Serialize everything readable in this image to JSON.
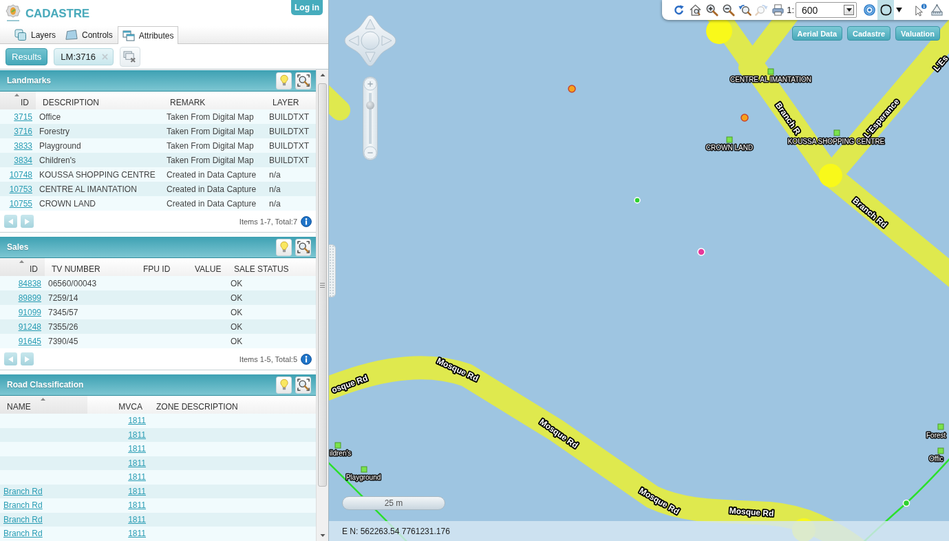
{
  "header": {
    "title": "CADASTRE",
    "login_button": "Log in"
  },
  "tabs": [
    {
      "label": "Layers",
      "selected": false
    },
    {
      "label": "Controls",
      "selected": false
    },
    {
      "label": "Attributes",
      "selected": true
    }
  ],
  "result_bar": {
    "results_button": "Results",
    "filter_chip": "LM:3716"
  },
  "panels": [
    {
      "title": "Landmarks",
      "columns": [
        {
          "label": "ID",
          "kind": "link",
          "sorted": true
        },
        {
          "label": "DESCRIPTION",
          "kind": "text",
          "sorted": false
        },
        {
          "label": "REMARK",
          "kind": "text",
          "sorted": false
        },
        {
          "label": "LAYER",
          "kind": "text",
          "sorted": false
        }
      ],
      "rows": [
        {
          "id": "3715",
          "description": "Office",
          "remark": "Taken From Digital Map",
          "layer": "BUILDTXT"
        },
        {
          "id": "3716",
          "description": "Forestry",
          "remark": "Taken From Digital Map",
          "layer": "BUILDTXT"
        },
        {
          "id": "3833",
          "description": "Playground",
          "remark": "Taken From Digital Map",
          "layer": "BUILDTXT"
        },
        {
          "id": "3834",
          "description": "Children's",
          "remark": "Taken From Digital Map",
          "layer": "BUILDTXT"
        },
        {
          "id": "10748",
          "description": "KOUSSA SHOPPING CENTRE",
          "remark": "Created in Data Capture",
          "layer": "n/a"
        },
        {
          "id": "10753",
          "description": "CENTRE AL IMANTATION",
          "remark": "Created in Data Capture",
          "layer": "n/a"
        },
        {
          "id": "10755",
          "description": "CROWN LAND",
          "remark": "Created in Data Capture",
          "layer": "n/a"
        }
      ],
      "footer": "Items 1-7, Total:7"
    },
    {
      "title": "Sales",
      "columns": [
        {
          "label": "ID",
          "kind": "link",
          "sorted": true
        },
        {
          "label": "TV NUMBER",
          "kind": "text",
          "sorted": false
        },
        {
          "label": "FPU ID",
          "sorted": false
        },
        {
          "label": "VALUE",
          "sorted": false
        },
        {
          "label": "SALE STATUS",
          "kind": "text",
          "sorted": false
        }
      ],
      "rows": [
        {
          "id": "84838",
          "tv_number": "06560/00043",
          "sale_status": "OK"
        },
        {
          "id": "89899",
          "tv_number": "7259/14",
          "sale_status": "OK"
        },
        {
          "id": "91099",
          "tv_number": "7345/57",
          "sale_status": "OK"
        },
        {
          "id": "91248",
          "tv_number": "7355/26",
          "sale_status": "OK"
        },
        {
          "id": "91645",
          "tv_number": "7390/45",
          "sale_status": "OK"
        }
      ],
      "footer": "Items 1-5, Total:5"
    },
    {
      "title": "Road Classification",
      "columns": [
        {
          "label": "NAME",
          "kind": "link",
          "sorted": true
        },
        {
          "label": "MVCA",
          "kind": "link",
          "sorted": false
        },
        {
          "label": "ZONE DESCRIPTION",
          "sorted": false
        }
      ],
      "rows": [
        {
          "mvca": "1811"
        },
        {
          "mvca": "1811"
        },
        {
          "mvca": "1811"
        },
        {
          "mvca": "1811"
        },
        {
          "mvca": "1811"
        },
        {
          "name": "Branch Rd",
          "mvca": "1811"
        },
        {
          "name": "Branch Rd",
          "mvca": "1811"
        },
        {
          "name": "Branch Rd",
          "mvca": "1811"
        },
        {
          "name": "Branch Rd",
          "mvca": "1811"
        }
      ]
    }
  ],
  "map": {
    "toolbar": {
      "tools": [
        {
          "selected": false,
          "disabled": false
        },
        {
          "selected": false,
          "disabled": false
        },
        {
          "selected": false,
          "disabled": false
        },
        {
          "selected": false,
          "disabled": false
        },
        {
          "selected": false,
          "disabled": false
        },
        {
          "selected": false,
          "disabled": true
        },
        {
          "selected": false,
          "disabled": false
        },
        {
          "selected": false,
          "disabled": false
        },
        {
          "selected": true,
          "disabled": false
        },
        {
          "selected": false,
          "disabled": false
        },
        {
          "selected": false,
          "disabled": false
        },
        {
          "selected": false,
          "disabled": false
        }
      ],
      "scale_prefix": "1:",
      "scale_value": "600"
    },
    "layer_buttons": [
      "Aerial Data",
      "Cadastre",
      "Valuation"
    ],
    "zoom_slider": {
      "level": 0.8
    },
    "road_labels": [
      "Branch R",
      "Branch Rd",
      "L'Esperance",
      "L'Es",
      "osque Rd",
      "Mosque Rd",
      "Mosque Rd",
      "Mosque Rd",
      "Mosque Rd"
    ],
    "place_labels": [
      "CENTRE AL IMANTATION",
      "CROWN LAND",
      "KOUSSA SHOPPING CENTRE",
      "ildren's",
      "Playground",
      "Forest",
      "Offic"
    ],
    "markers": [
      {
        "color": "#f7a21b"
      },
      {
        "color": "#f7a21b"
      },
      {
        "color": "#2fd12f"
      },
      {
        "color": "#e8389a"
      },
      {
        "color": "#2fd12f"
      }
    ],
    "scale_bar": "25 m",
    "coordinates": "E N: 562263.54 7761231.176"
  }
}
